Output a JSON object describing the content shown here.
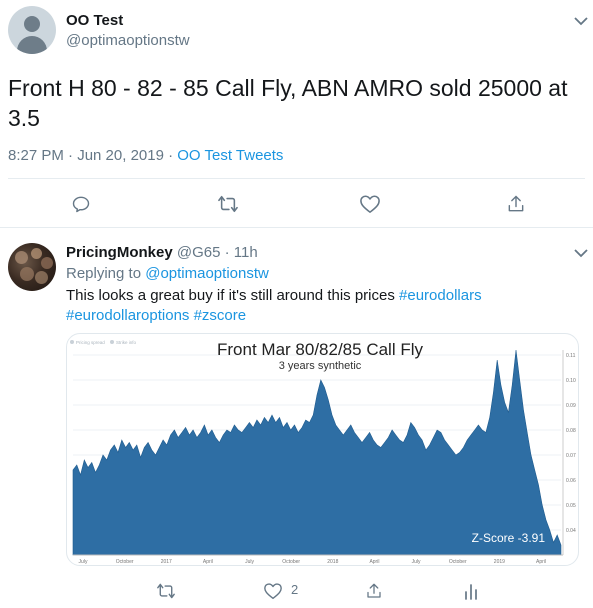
{
  "main_tweet": {
    "name": "OO Test",
    "handle": "@optimaoptionstw",
    "text": "Front H 80 - 82 - 85 Call Fly, ABN AMRO sold 25000 at 3.5",
    "time_date": "8:27 PM · Jun 20, 2019 · ",
    "source": "OO Test Tweets"
  },
  "reply_tweet": {
    "name": "PricingMonkey",
    "handle_time": "@G65 · 11h",
    "replying_prefix": "Replying to ",
    "replying_handle": "@optimaoptionstw",
    "text_plain": "This looks a great buy if it's still around this prices ",
    "hashtag1": "#eurodollars",
    "hashtag2": "#eurodollaroptions",
    "hashtag3": "#zscore",
    "like_count": "2"
  },
  "chart_data": {
    "type": "area",
    "title": "Front Mar 80/82/85 Call Fly",
    "subtitle": "3 years synthetic",
    "annotation": "Z-Score -3.91",
    "legend": [
      "Pricing spread",
      "Strike info"
    ],
    "legend_placement": "top-left",
    "x_tick_labels": [
      "July",
      "October",
      "2017",
      "April",
      "July",
      "October",
      "2018",
      "April",
      "July",
      "October",
      "2019",
      "April"
    ],
    "y_tick_labels": [
      "0.11",
      "0.10",
      "0.09",
      "0.08",
      "0.07",
      "0.06",
      "0.05",
      "0.04"
    ],
    "ylim": [
      0.03,
      0.112
    ],
    "grid": true,
    "color": "#2e6ea4",
    "series": [
      {
        "values": [
          0.064,
          0.066,
          0.062,
          0.068,
          0.065,
          0.067,
          0.063,
          0.066,
          0.07,
          0.068,
          0.072,
          0.074,
          0.071,
          0.076,
          0.073,
          0.075,
          0.072,
          0.074,
          0.069,
          0.073,
          0.075,
          0.072,
          0.07,
          0.073,
          0.076,
          0.074,
          0.078,
          0.08,
          0.077,
          0.079,
          0.081,
          0.078,
          0.08,
          0.077,
          0.079,
          0.082,
          0.078,
          0.08,
          0.077,
          0.075,
          0.078,
          0.08,
          0.079,
          0.082,
          0.08,
          0.079,
          0.081,
          0.083,
          0.081,
          0.084,
          0.082,
          0.085,
          0.083,
          0.086,
          0.083,
          0.085,
          0.081,
          0.083,
          0.08,
          0.082,
          0.079,
          0.081,
          0.084,
          0.083,
          0.086,
          0.094,
          0.1,
          0.097,
          0.092,
          0.086,
          0.082,
          0.08,
          0.078,
          0.08,
          0.082,
          0.079,
          0.077,
          0.075,
          0.077,
          0.079,
          0.076,
          0.074,
          0.073,
          0.075,
          0.077,
          0.08,
          0.078,
          0.076,
          0.075,
          0.078,
          0.083,
          0.081,
          0.078,
          0.076,
          0.072,
          0.074,
          0.077,
          0.08,
          0.079,
          0.076,
          0.074,
          0.072,
          0.07,
          0.071,
          0.073,
          0.076,
          0.078,
          0.08,
          0.082,
          0.08,
          0.079,
          0.085,
          0.095,
          0.108,
          0.098,
          0.091,
          0.087,
          0.098,
          0.112,
          0.1,
          0.088,
          0.079,
          0.07,
          0.064,
          0.058,
          0.05,
          0.044,
          0.04,
          0.035,
          0.038,
          0.034
        ]
      }
    ]
  },
  "icons": {
    "caret": "chevron-down-icon",
    "reply": "reply-icon",
    "retweet": "retweet-icon",
    "like": "heart-icon",
    "share": "share-icon",
    "analytics": "analytics-icon"
  },
  "colors": {
    "link": "#1b95e0",
    "muted": "#657786",
    "chart": "#2e6ea4"
  }
}
